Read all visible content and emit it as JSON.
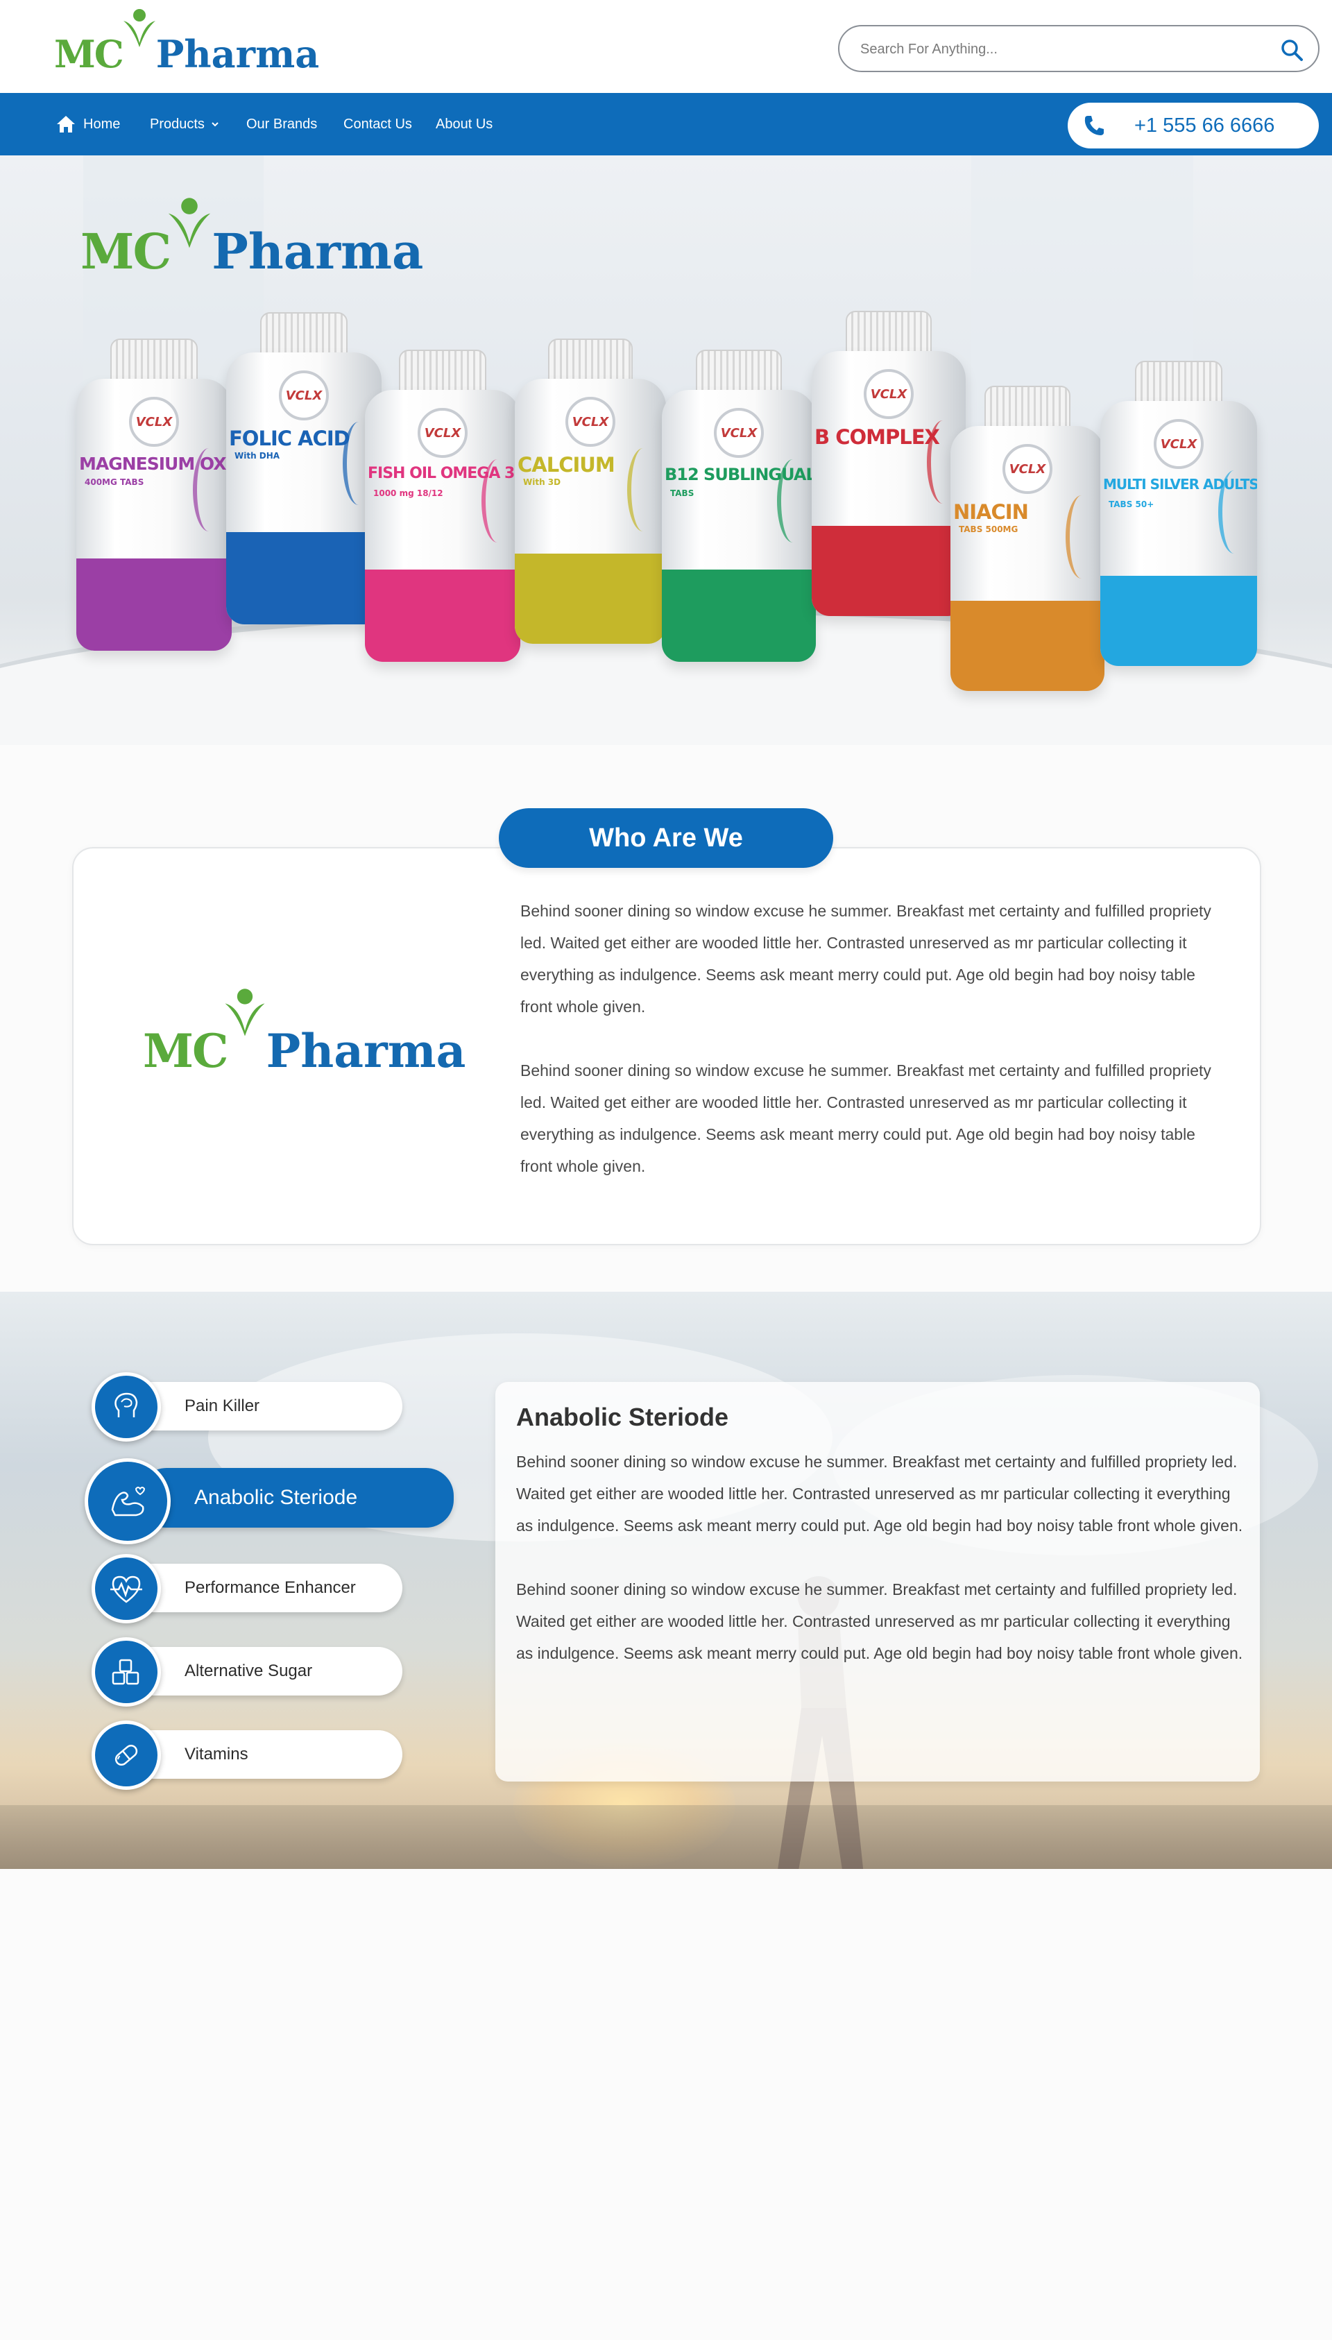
{
  "brand": {
    "part1": "MC",
    "part2": "Pharma"
  },
  "search": {
    "placeholder": "Search For Anything..."
  },
  "nav": {
    "items": [
      {
        "label": "Home"
      },
      {
        "label": "Products"
      },
      {
        "label": "Our Brands"
      },
      {
        "label": "Contact Us"
      },
      {
        "label": "About Us"
      }
    ],
    "phone": "+1 555 66 6666"
  },
  "hero": {
    "bottles": [
      {
        "brand": "VCLX",
        "name": "MAGNESIUM OXIDE",
        "sub": "400MG TABS",
        "color": "#9b3fa5"
      },
      {
        "brand": "VCLX",
        "name": "FOLIC ACID",
        "sub": "With DHA",
        "color": "#1a63b5"
      },
      {
        "brand": "VCLX",
        "name": "FISH OIL OMEGA 3",
        "sub": "1000 mg 18/12",
        "color": "#e0357f"
      },
      {
        "brand": "VCLX",
        "name": "CALCIUM",
        "sub": "With 3D",
        "color": "#c4b72a"
      },
      {
        "brand": "VCLX",
        "name": "B12 SUBLINGUAL",
        "sub": "TABS",
        "color": "#1e9c5e"
      },
      {
        "brand": "VCLX",
        "name": "B COMPLEX",
        "sub": "",
        "color": "#cf2d3a"
      },
      {
        "brand": "VCLX",
        "name": "NIACIN",
        "sub": "TABS 500MG",
        "color": "#d98a2b"
      },
      {
        "brand": "VCLX",
        "name": "MULTI SILVER ADULTS",
        "sub": "TABS 50+",
        "color": "#23a7e0"
      }
    ]
  },
  "who": {
    "title": "Who Are We",
    "paragraphs": [
      "Behind sooner dining so window excuse he summer. Breakfast met certainty and fulfilled propriety led. Waited get either are wooded little her. Contrasted unreserved as mr particular collecting it everything as indulgence. Seems ask meant merry could put. Age old begin had boy noisy table front whole given.",
      "Behind sooner dining so window excuse he summer. Breakfast met certainty and fulfilled propriety led. Waited get either are wooded little her. Contrasted unreserved as mr particular collecting it everything as indulgence. Seems ask meant merry could put. Age old begin had boy noisy table front whole given."
    ]
  },
  "categories": {
    "items": [
      {
        "label": "Pain Killer",
        "icon": "head-icon",
        "active": false
      },
      {
        "label": "Anabolic Steriode",
        "icon": "muscle-icon",
        "active": true
      },
      {
        "label": "Performance Enhancer",
        "icon": "heartbeat-icon",
        "active": false
      },
      {
        "label": "Alternative Sugar",
        "icon": "sugar-cubes-icon",
        "active": false
      },
      {
        "label": "Vitamins",
        "icon": "pill-icon",
        "active": false
      }
    ],
    "detail": {
      "title": "Anabolic Steriode",
      "paragraphs": [
        "Behind sooner dining so window excuse he summer. Breakfast met certainty and fulfilled propriety led. Waited get either are wooded little her. Contrasted unreserved as mr particular collecting it everything as indulgence. Seems ask meant merry could put. Age old begin had boy noisy table front whole given.",
        "Behind sooner dining so window excuse he summer. Breakfast met certainty and fulfilled propriety led. Waited get either are wooded little her. Contrasted unreserved as mr particular collecting it everything as indulgence. Seems ask meant merry could put. Age old begin had boy noisy table front whole given."
      ]
    }
  },
  "colors": {
    "primary": "#0e6cba",
    "logo_green": "#5aaa3c",
    "logo_blue": "#1469b0"
  }
}
